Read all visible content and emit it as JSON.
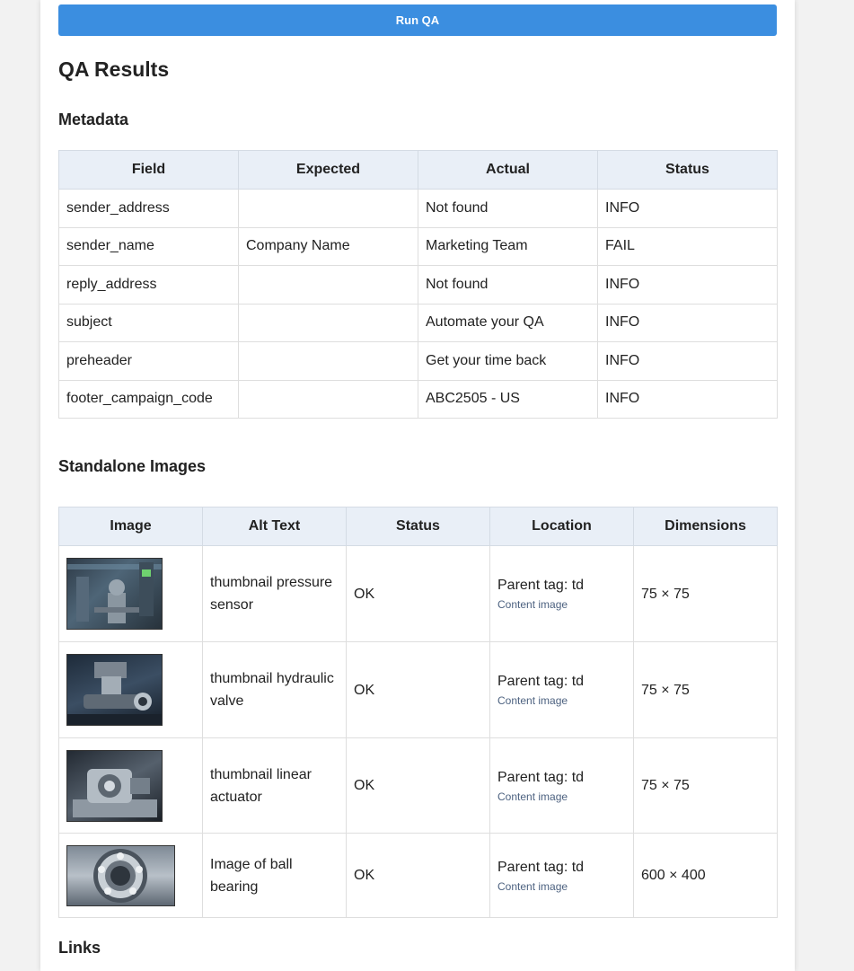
{
  "run_button": {
    "label": "Run QA"
  },
  "results_title": "QA Results",
  "metadata": {
    "title": "Metadata",
    "headers": [
      "Field",
      "Expected",
      "Actual",
      "Status"
    ],
    "rows": [
      {
        "field": "sender_address",
        "expected": "",
        "actual": "Not found",
        "status": "INFO"
      },
      {
        "field": "sender_name",
        "expected": "Company Name",
        "actual": "Marketing Team",
        "status": "FAIL"
      },
      {
        "field": "reply_address",
        "expected": "",
        "actual": "Not found",
        "status": "INFO"
      },
      {
        "field": "subject",
        "expected": "",
        "actual": "Automate your QA",
        "status": "INFO"
      },
      {
        "field": "preheader",
        "expected": "",
        "actual": "Get your time back",
        "status": "INFO"
      },
      {
        "field": "footer_campaign_code",
        "expected": "",
        "actual": "ABC2505 - US",
        "status": "INFO"
      }
    ]
  },
  "standalone_images": {
    "title": "Standalone Images",
    "headers": [
      "Image",
      "Alt Text",
      "Status",
      "Location",
      "Dimensions"
    ],
    "rows": [
      {
        "thumbnail_icon": "pressure-sensor-photo",
        "alt_text": "thumbnail pressure sensor",
        "status": "OK",
        "location": "Parent tag: td",
        "location_note": "Content image",
        "dimensions": "75 × 75"
      },
      {
        "thumbnail_icon": "hydraulic-valve-photo",
        "alt_text": "thumbnail hydraulic valve",
        "status": "OK",
        "location": "Parent tag: td",
        "location_note": "Content image",
        "dimensions": "75 × 75"
      },
      {
        "thumbnail_icon": "linear-actuator-photo",
        "alt_text": "thumbnail linear actuator",
        "status": "OK",
        "location": "Parent tag: td",
        "location_note": "Content image",
        "dimensions": "75 × 75"
      },
      {
        "thumbnail_icon": "ball-bearing-photo",
        "alt_text": "Image of ball bearing",
        "status": "OK",
        "location": "Parent tag: td",
        "location_note": "Content image",
        "dimensions": "600 × 400"
      }
    ]
  },
  "links": {
    "title": "Links"
  },
  "colors": {
    "button": "#3b8ee0",
    "status_info": "#2f86d6",
    "status_fail": "#d8322b",
    "status_ok": "#2b9a4b",
    "table_header_bg": "#e9eff7"
  }
}
